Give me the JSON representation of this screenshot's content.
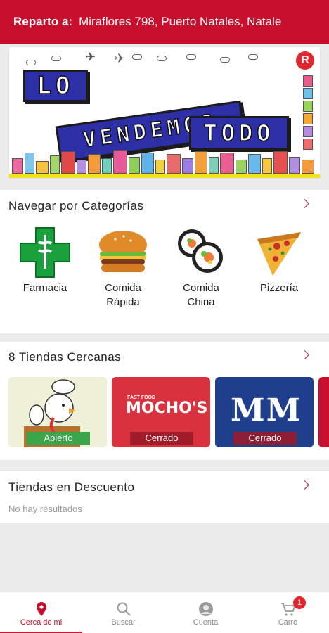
{
  "header": {
    "label": "Reparto a:",
    "address": "Miraflores 798, Puerto Natales, Natale"
  },
  "banner": {
    "line1": "LO",
    "line2": "VENDEMOS",
    "line3": "TODO"
  },
  "categories": {
    "title": "Navegar por Categorías",
    "items": [
      {
        "label": "Farmacia",
        "icon": "pharmacy-cross-icon"
      },
      {
        "label": "Comida Rápida",
        "icon": "burger-icon"
      },
      {
        "label": "Comida China",
        "icon": "sushi-icon"
      },
      {
        "label": "Pizzería",
        "icon": "pizza-icon"
      }
    ]
  },
  "stores": {
    "title": "8 Tiendas Cercanas",
    "items": [
      {
        "status": "Abierto",
        "status_color": "#3aa64a"
      },
      {
        "name": "MOCHO'S",
        "tag": "FAST FOOD",
        "status": "Cerrado",
        "status_color": "#a11c2a"
      },
      {
        "name": "MM",
        "status": "Cerrado",
        "status_color": "#8c1f33"
      }
    ]
  },
  "discount": {
    "title": "Tiendas en Descuento",
    "empty": "No hay resultados"
  },
  "nav": {
    "items": [
      {
        "label": "Cerca de mi",
        "icon": "location-pin-icon"
      },
      {
        "label": "Buscar",
        "icon": "search-icon"
      },
      {
        "label": "Cuenta",
        "icon": "user-icon"
      },
      {
        "label": "Carro",
        "icon": "cart-icon"
      }
    ],
    "cart_count": "1"
  },
  "colors": {
    "brand": "#c8102e"
  }
}
